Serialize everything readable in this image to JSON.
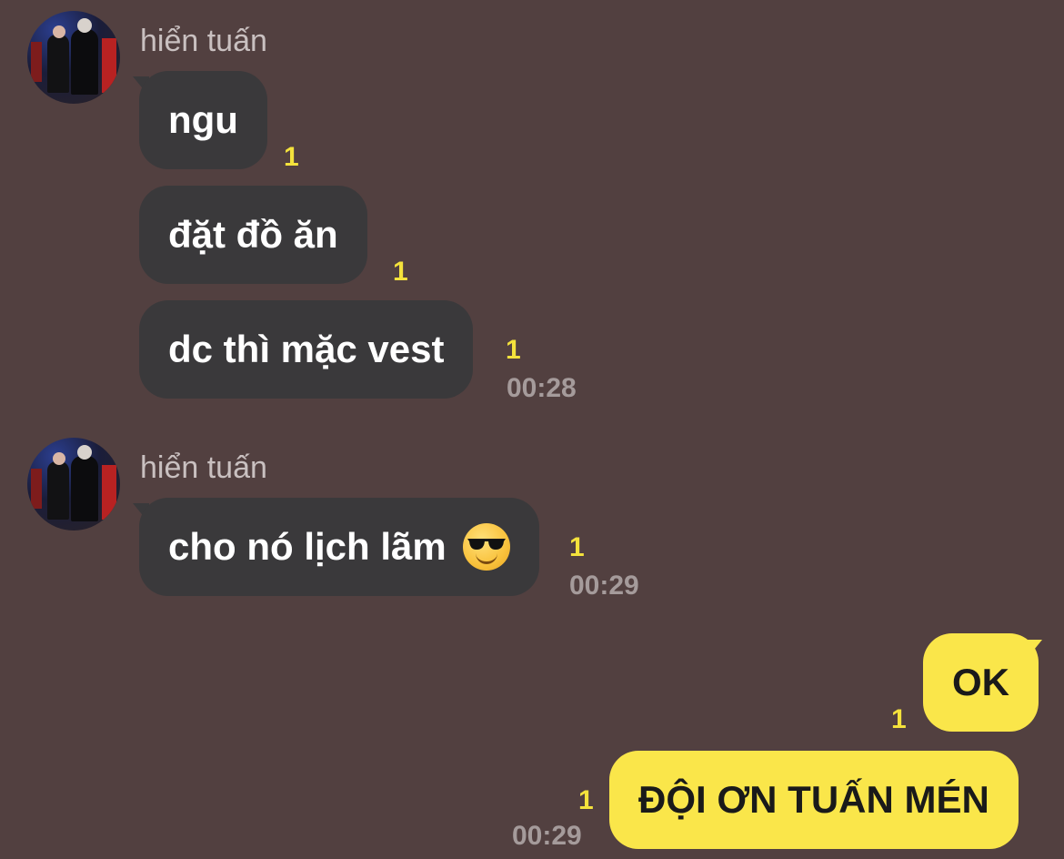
{
  "groups": [
    {
      "sender": "hiển tuấn",
      "messages": [
        {
          "text": "ngu",
          "unread": "1"
        },
        {
          "text": "đặt đồ ăn",
          "unread": "1"
        },
        {
          "text": "dc thì mặc vest",
          "unread": "1",
          "time": "00:28"
        }
      ]
    },
    {
      "sender": "hiển tuấn",
      "messages": [
        {
          "text": "cho nó lịch lãm",
          "emoji": "smiling-face-with-sunglasses",
          "unread": "1",
          "time": "00:29"
        }
      ]
    }
  ],
  "outgoing": [
    {
      "text": "OK",
      "unread": "1"
    },
    {
      "text": "ĐỘI ƠN TUẤN MÉN",
      "unread": "1",
      "time": "00:29"
    }
  ],
  "colors": {
    "background": "#524040",
    "incoming_bubble": "#3a393b",
    "outgoing_bubble": "#fae64a",
    "unread": "#f4e23c"
  }
}
